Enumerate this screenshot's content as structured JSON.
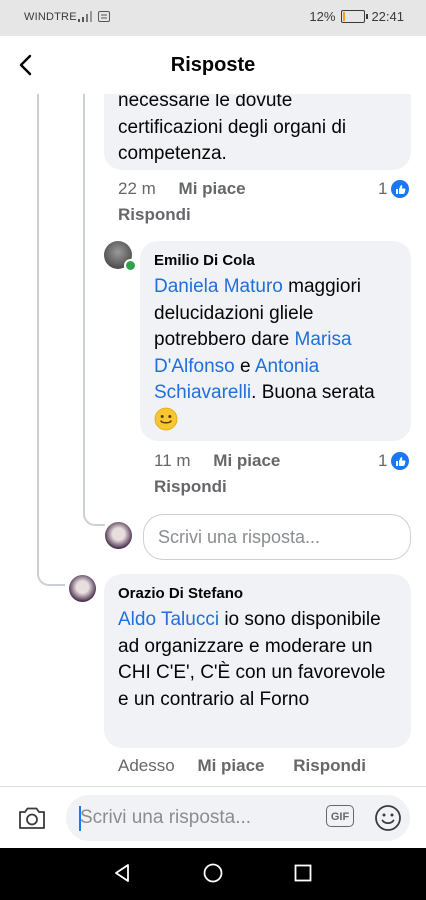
{
  "status_bar": {
    "carrier": "WINDTRE",
    "battery": "12%",
    "battery_level": 0.12,
    "time": "22:41"
  },
  "header": {
    "title": "Risposte",
    "back_icon": "chevron-left-icon"
  },
  "comment1": {
    "text_lines": [
      "necessarie le dovute",
      "certificazioni degli organi di",
      "competenza."
    ],
    "time": "22 m",
    "like": "Mi piace",
    "reply": "Rispondi",
    "like_count": "1"
  },
  "comment2": {
    "author": "Emilio Di Cola",
    "mention1": "Daniela Maturo",
    "text1": " maggiori delucidazioni gliele potrebbero dare ",
    "mention2": "Marisa D'Alfonso",
    "text2": " e ",
    "mention3": "Antonia Schiavarelli",
    "text3": ". Buona serata ",
    "emoji": "slightly-smiling-face-icon",
    "time": "11 m",
    "like": "Mi piace",
    "reply": "Rispondi",
    "like_count": "1"
  },
  "reply_box": {
    "placeholder": "Scrivi una risposta..."
  },
  "comment3": {
    "author": "Orazio Di Stefano",
    "mention": "Aldo Talucci",
    "text": " io sono disponibile ad organizzare e moderare un CHI C'E', C'È con un favorevole e un contrario al Forno",
    "time": "Adesso",
    "like": "Mi piace",
    "reply": "Rispondi"
  },
  "composer": {
    "placeholder": "Scrivi una risposta...",
    "gif_label": "GIF",
    "camera_icon": "camera-icon",
    "emoji_icon": "smiley-icon"
  },
  "colors": {
    "mention": "#216fdb",
    "like": "#1877f2",
    "bubble": "#f0f2f5",
    "meta": "#65676b"
  }
}
